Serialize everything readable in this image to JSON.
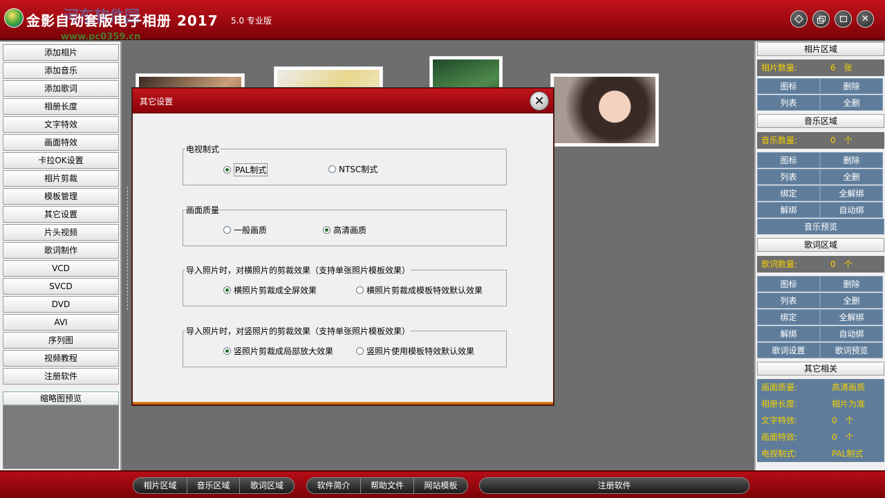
{
  "app": {
    "title": "金影自动套版电子相册 2017",
    "version": "5.0 专业版",
    "watermark_site": "河东软件园",
    "watermark_url": "www.pc0359.cn"
  },
  "window_controls": {
    "icons": [
      "diamond-icon",
      "restore-icon",
      "maximize-icon",
      "close-icon"
    ]
  },
  "left_menu": [
    "添加相片",
    "添加音乐",
    "添加歌词",
    "相册长度",
    "文字特效",
    "画面特效",
    "卡拉OK设置",
    "相片剪裁",
    "模板管理",
    "其它设置",
    "片头视频",
    "歌词制作",
    "VCD",
    "SVCD",
    "DVD",
    "AVI",
    "序列图",
    "视频教程",
    "注册软件"
  ],
  "thumbnail_preview": {
    "label": "缩略图预览"
  },
  "dialog": {
    "title": "其它设置",
    "groups": [
      {
        "label": "电视制式",
        "options": [
          {
            "label": "PAL制式",
            "selected": true
          },
          {
            "label": "NTSC制式",
            "selected": false
          }
        ]
      },
      {
        "label": "画面质量",
        "options": [
          {
            "label": "一般画质",
            "selected": false
          },
          {
            "label": "高清画质",
            "selected": true
          }
        ]
      },
      {
        "label": "导入照片时，对横照片的剪裁效果（支持单张照片模板效果）",
        "options": [
          {
            "label": "横照片剪裁成全屏效果",
            "selected": true
          },
          {
            "label": "横照片剪裁成模板特效默认效果",
            "selected": false
          }
        ]
      },
      {
        "label": "导入照片时，对竖照片的剪裁效果（支持单张照片模板效果）",
        "options": [
          {
            "label": "竖照片剪裁成局部放大效果",
            "selected": true
          },
          {
            "label": "竖照片使用模板特效默认效果",
            "selected": false
          }
        ]
      }
    ]
  },
  "right_panel": {
    "photo": {
      "header": "相片区域",
      "count_label": "相片数量:",
      "count_value": "6　张",
      "buttons": [
        "图标",
        "删除",
        "列表",
        "全删"
      ]
    },
    "music": {
      "header": "音乐区域",
      "count_label": "音乐数量:",
      "count_value": "0　个",
      "buttons": [
        "图标",
        "删除",
        "列表",
        "全删",
        "绑定",
        "全解绑",
        "解绑",
        "自动绑"
      ],
      "preview": "音乐预览"
    },
    "lyrics": {
      "header": "歌词区域",
      "count_label": "歌词数量:",
      "count_value": "0　个",
      "buttons": [
        "图标",
        "删除",
        "列表",
        "全删",
        "绑定",
        "全解绑",
        "解绑",
        "自动绑",
        "歌词设置",
        "歌词预览"
      ]
    },
    "other": {
      "header": "其它相关",
      "rows": [
        {
          "k": "画面质量:",
          "v": "高清画质"
        },
        {
          "k": "相册长度:",
          "v": "相片为准"
        },
        {
          "k": "文字特效:",
          "v": "0　个"
        },
        {
          "k": "画面特效:",
          "v": "0　个"
        },
        {
          "k": "电视制式:",
          "v": "PAL制式"
        }
      ]
    }
  },
  "bottom_bar": {
    "group1": [
      "相片区域",
      "音乐区域",
      "歌词区域"
    ],
    "group2": [
      "软件简介",
      "帮助文件",
      "网站模板"
    ],
    "register": "注册软件"
  }
}
